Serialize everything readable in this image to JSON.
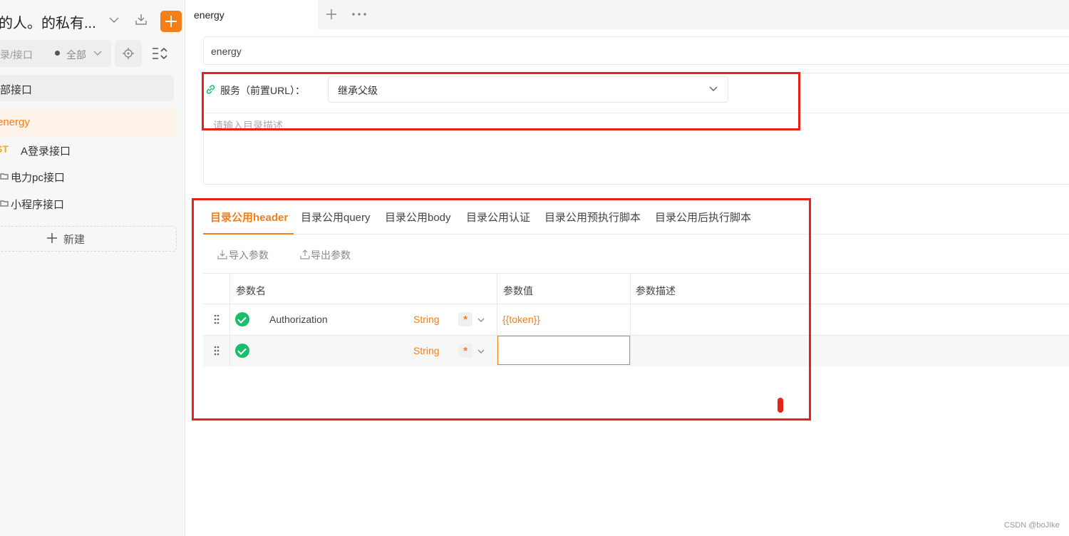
{
  "sidebar": {
    "project_title": "的人。的私有...",
    "search_placeholder": "录/接口",
    "filter_label": "全部",
    "all_api_label": "部接口",
    "active_item": "energy",
    "items": [
      {
        "method": "ST",
        "label": "A登录接口"
      },
      {
        "label": "电力pc接口"
      },
      {
        "label": "小程序接口"
      }
    ],
    "new_label": "新建"
  },
  "tabbar": {
    "active_tab": "energy"
  },
  "form": {
    "name_value": "energy",
    "service_label": "服务（前置URL）：",
    "service_value": "继承父级",
    "description_placeholder": "请输入目录描述"
  },
  "detail_tabs": [
    {
      "label": "目录公用header",
      "active": true
    },
    {
      "label": "目录公用query"
    },
    {
      "label": "目录公用body"
    },
    {
      "label": "目录公用认证"
    },
    {
      "label": "目录公用预执行脚本"
    },
    {
      "label": "目录公用后执行脚本"
    }
  ],
  "toolbar": {
    "import_label": "导入参数",
    "export_label": "导出参数"
  },
  "table": {
    "headers": [
      "参数名",
      "参数值",
      "参数描述"
    ],
    "rows": [
      {
        "name": "Authorization",
        "type": "String",
        "required": "*",
        "value": "{{token}}",
        "description": ""
      },
      {
        "name": "",
        "type": "String",
        "required": "*",
        "value": "",
        "description": ""
      }
    ]
  },
  "watermark": "CSDN @boJIke",
  "colors": {
    "accent": "#f57f17",
    "check": "#19be6b",
    "annotation": "#e8221b"
  }
}
